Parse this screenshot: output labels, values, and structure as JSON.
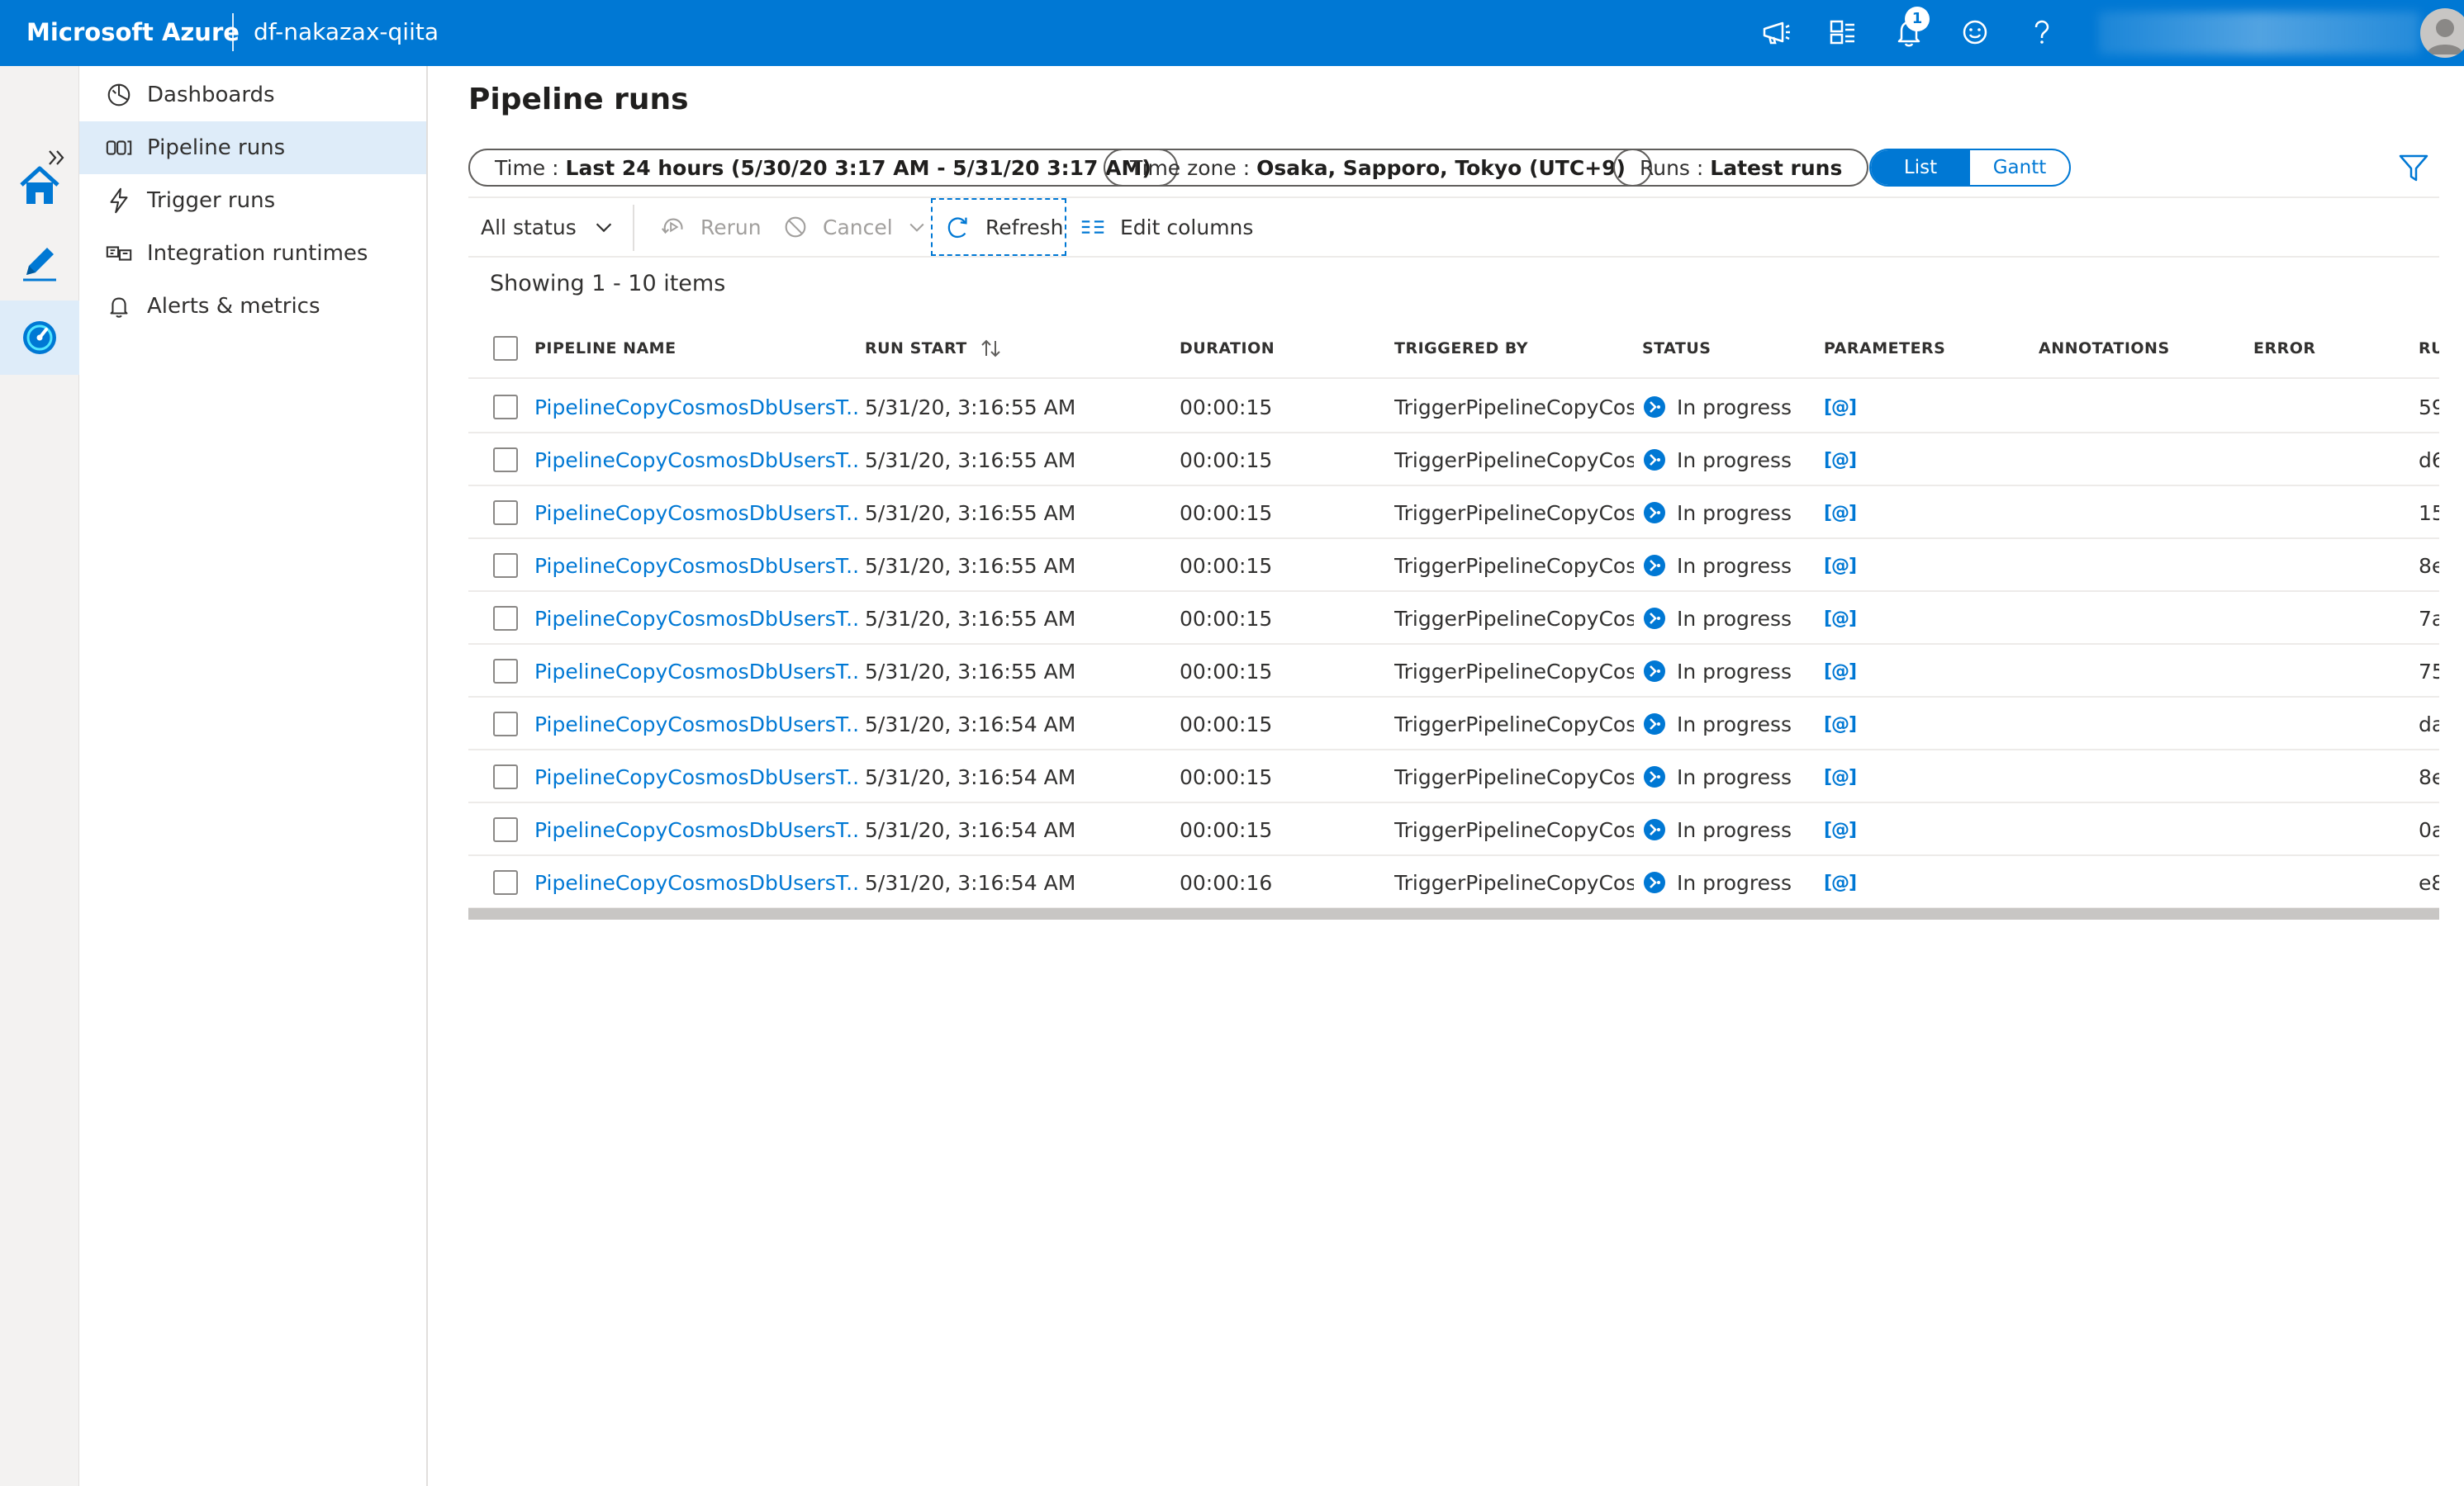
{
  "topbar": {
    "brand": "Microsoft Azure",
    "factory_name": "df-nakazax-qiita",
    "notification_count": "1",
    "icons": [
      "megaphone-icon",
      "directory-switch-icon",
      "bell-icon",
      "smiley-icon",
      "help-icon",
      "avatar-icon"
    ]
  },
  "rail": {
    "items": [
      "home-icon",
      "author-pencil-icon",
      "monitor-gauge-icon"
    ],
    "active": "monitor-gauge-icon"
  },
  "sidenav": {
    "items": [
      {
        "label": "Dashboards",
        "icon": "dashboard-icon"
      },
      {
        "label": "Pipeline runs",
        "icon": "pipeline-runs-icon",
        "active": true
      },
      {
        "label": "Trigger runs",
        "icon": "trigger-icon"
      },
      {
        "label": "Integration runtimes",
        "icon": "integration-runtime-icon"
      },
      {
        "label": "Alerts & metrics",
        "icon": "bell-icon"
      }
    ]
  },
  "page": {
    "title": "Pipeline runs",
    "filters": {
      "time_key": "Time : ",
      "time_value": "Last 24 hours (5/30/20 3:17 AM - 5/31/20 3:17 AM)",
      "tz_key": "Time zone : ",
      "tz_value": "Osaka, Sapporo, Tokyo (UTC+9)",
      "runs_key": "Runs : ",
      "runs_value": "Latest runs"
    },
    "view_toggle": {
      "list": "List",
      "gantt": "Gantt",
      "selected": "List"
    }
  },
  "commands": {
    "status": "All status",
    "rerun": "Rerun",
    "cancel": "Cancel",
    "refresh": "Refresh",
    "edit_columns": "Edit columns"
  },
  "table": {
    "showing": "Showing 1 - 10 items",
    "columns": {
      "name": "PIPELINE NAME",
      "start": "RUN START",
      "duration": "DURATION",
      "triggered": "TRIGGERED BY",
      "status": "STATUS",
      "parameters": "PARAMETERS",
      "annotations": "ANNOTATIONS",
      "error": "ERROR",
      "runid": "RU"
    },
    "param_glyph": "[@]",
    "rows": [
      {
        "name": "PipelineCopyCosmosDbUsersT...",
        "start": "5/31/20, 3:16:55 AM",
        "duration": "00:00:15",
        "triggered": "TriggerPipelineCopyCosn",
        "status": "In progress",
        "runid": "59"
      },
      {
        "name": "PipelineCopyCosmosDbUsersT...",
        "start": "5/31/20, 3:16:55 AM",
        "duration": "00:00:15",
        "triggered": "TriggerPipelineCopyCosn",
        "status": "In progress",
        "runid": "d6"
      },
      {
        "name": "PipelineCopyCosmosDbUsersT...",
        "start": "5/31/20, 3:16:55 AM",
        "duration": "00:00:15",
        "triggered": "TriggerPipelineCopyCosn",
        "status": "In progress",
        "runid": "15"
      },
      {
        "name": "PipelineCopyCosmosDbUsersT...",
        "start": "5/31/20, 3:16:55 AM",
        "duration": "00:00:15",
        "triggered": "TriggerPipelineCopyCosn",
        "status": "In progress",
        "runid": "8e"
      },
      {
        "name": "PipelineCopyCosmosDbUsersT...",
        "start": "5/31/20, 3:16:55 AM",
        "duration": "00:00:15",
        "triggered": "TriggerPipelineCopyCosn",
        "status": "In progress",
        "runid": "7a"
      },
      {
        "name": "PipelineCopyCosmosDbUsersT...",
        "start": "5/31/20, 3:16:55 AM",
        "duration": "00:00:15",
        "triggered": "TriggerPipelineCopyCosn",
        "status": "In progress",
        "runid": "75"
      },
      {
        "name": "PipelineCopyCosmosDbUsersT...",
        "start": "5/31/20, 3:16:54 AM",
        "duration": "00:00:15",
        "triggered": "TriggerPipelineCopyCosn",
        "status": "In progress",
        "runid": "da"
      },
      {
        "name": "PipelineCopyCosmosDbUsersT...",
        "start": "5/31/20, 3:16:54 AM",
        "duration": "00:00:15",
        "triggered": "TriggerPipelineCopyCosn",
        "status": "In progress",
        "runid": "8e"
      },
      {
        "name": "PipelineCopyCosmosDbUsersT...",
        "start": "5/31/20, 3:16:54 AM",
        "duration": "00:00:15",
        "triggered": "TriggerPipelineCopyCosn",
        "status": "In progress",
        "runid": "0a"
      },
      {
        "name": "PipelineCopyCosmosDbUsersT...",
        "start": "5/31/20, 3:16:54 AM",
        "duration": "00:00:16",
        "triggered": "TriggerPipelineCopyCosn",
        "status": "In progress",
        "runid": "e8"
      }
    ]
  },
  "colors": {
    "accent": "#0078d4",
    "topbar": "#0078d4",
    "selected_bg": "#deecf9",
    "disabled": "#a19f9d"
  }
}
